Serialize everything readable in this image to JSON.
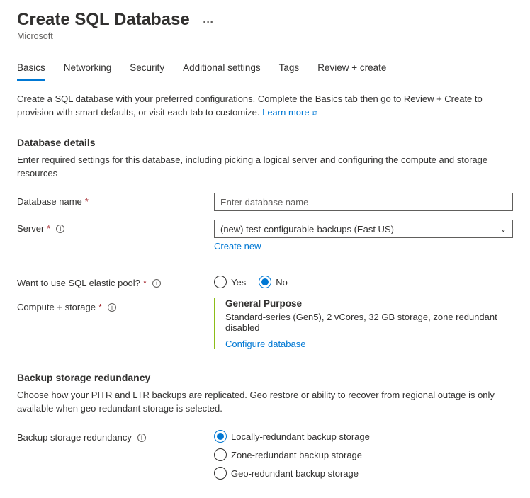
{
  "header": {
    "title": "Create SQL Database",
    "subtitle": "Microsoft",
    "menu_icon": "…"
  },
  "tabs": [
    {
      "label": "Basics",
      "active": true
    },
    {
      "label": "Networking",
      "active": false
    },
    {
      "label": "Security",
      "active": false
    },
    {
      "label": "Additional settings",
      "active": false
    },
    {
      "label": "Tags",
      "active": false
    },
    {
      "label": "Review + create",
      "active": false
    }
  ],
  "intro": {
    "text_a": "Create a SQL database with your preferred configurations. Complete the Basics tab then go to Review + Create to provision with smart defaults, or visit each tab to customize. ",
    "learn_more": "Learn more"
  },
  "database_details": {
    "heading": "Database details",
    "desc": "Enter required settings for this database, including picking a logical server and configuring the compute and storage resources",
    "db_name": {
      "label": "Database name",
      "placeholder": "Enter database name",
      "value": ""
    },
    "server": {
      "label": "Server",
      "value": "(new) test-configurable-backups (East US)",
      "create_new": "Create new"
    },
    "elastic_pool": {
      "label": "Want to use SQL elastic pool?",
      "options": {
        "yes": "Yes",
        "no": "No"
      },
      "selected": "no"
    },
    "compute": {
      "label": "Compute + storage",
      "title": "General Purpose",
      "desc": "Standard-series (Gen5), 2 vCores, 32 GB storage, zone redundant disabled",
      "configure": "Configure database"
    }
  },
  "backup": {
    "heading": "Backup storage redundancy",
    "desc": "Choose how your PITR and LTR backups are replicated. Geo restore or ability to recover from regional outage is only available when geo-redundant storage is selected.",
    "label": "Backup storage redundancy",
    "options": {
      "local": "Locally-redundant backup storage",
      "zone": "Zone-redundant backup storage",
      "geo": "Geo-redundant backup storage"
    },
    "selected": "local"
  }
}
